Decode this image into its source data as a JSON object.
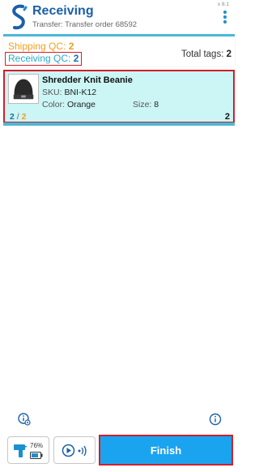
{
  "header": {
    "title": "Receiving",
    "subtitle": "Transfer: Transfer order 68592",
    "version": "v 8.1"
  },
  "summary": {
    "shipping_qc_label": "Shipping QC:",
    "shipping_qc_value": "2",
    "receiving_qc_label": "Receiving QC:",
    "receiving_qc_value": "2",
    "total_tags_label": "Total tags:",
    "total_tags_value": "2"
  },
  "item": {
    "name": "Shredder Knit Beanie",
    "sku_label": "SKU:",
    "sku_value": "BNI-K12",
    "color_label": "Color:",
    "color_value": "Orange",
    "size_label": "Size:",
    "size_value": "8",
    "received_count": "2",
    "count_separator": "/",
    "expected_count": "2",
    "quantity": "2"
  },
  "toolbar": {
    "battery_level": "76%",
    "finish_label": "Finish"
  },
  "colors": {
    "brand_blue": "#1b5fa8",
    "accent_teal": "#4cb8d8",
    "shipping_orange": "#f0a020",
    "item_bg": "#ccf5f5",
    "finish_blue": "#1aa4f0",
    "highlight_red": "#d0202a"
  },
  "icons": {
    "logo": "app-logo-icon",
    "menu": "more-vertical-icon",
    "settings": "settings-info-icon",
    "info": "info-icon",
    "scanner": "scanner-gun-icon",
    "battery": "battery-icon",
    "play": "play-circle-icon",
    "signal": "rfid-signal-icon"
  }
}
